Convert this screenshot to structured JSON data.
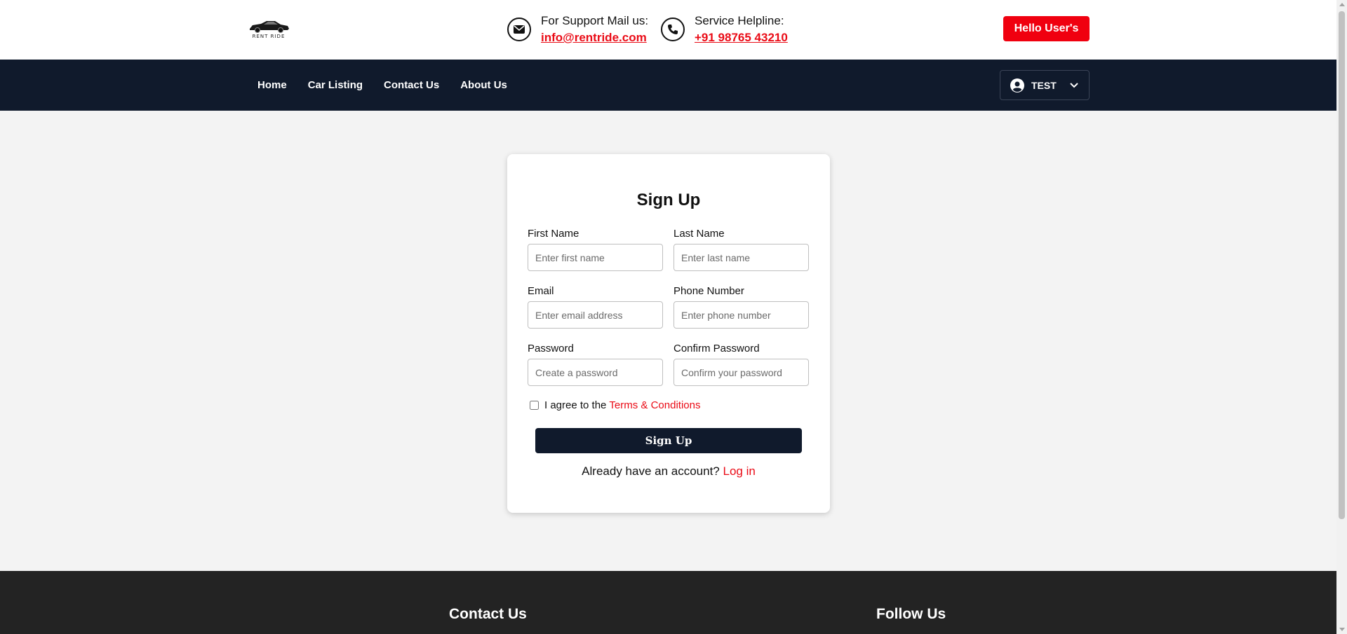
{
  "header": {
    "logo_text": "RENT RIDE",
    "support_label": "For Support Mail us:",
    "support_email": "info@rentride.com",
    "helpline_label": "Service Helpline:",
    "helpline_phone": "+91 98765 43210",
    "hello_button": "Hello User's"
  },
  "nav": {
    "items": [
      {
        "label": "Home"
      },
      {
        "label": "Car Listing"
      },
      {
        "label": "Contact Us"
      },
      {
        "label": "About Us"
      }
    ],
    "user_name": "TEST"
  },
  "form": {
    "title": "Sign Up",
    "fields": {
      "first_name": {
        "label": "First Name",
        "placeholder": "Enter first name"
      },
      "last_name": {
        "label": "Last Name",
        "placeholder": "Enter last name"
      },
      "email": {
        "label": "Email",
        "placeholder": "Enter email address"
      },
      "phone": {
        "label": "Phone Number",
        "placeholder": "Enter phone number"
      },
      "password": {
        "label": "Password",
        "placeholder": "Create a password"
      },
      "confirm_password": {
        "label": "Confirm Password",
        "placeholder": "Confirm your password"
      }
    },
    "agree_text": "I agree to the",
    "terms_link": "Terms & Conditions",
    "submit": "Sign Up",
    "login_prompt": "Already have an account?",
    "login_link": "Log in"
  },
  "footer": {
    "contact_heading": "Contact Us",
    "follow_heading": "Follow Us"
  },
  "colors": {
    "accent_red": "#f0000f",
    "navy": "#101a2c",
    "footer_dark": "#232323"
  }
}
